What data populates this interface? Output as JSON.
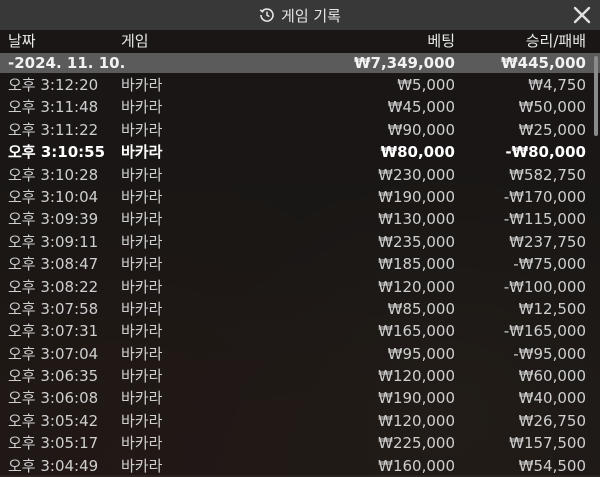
{
  "window": {
    "title": "게임 기록"
  },
  "columns": {
    "date": "날짜",
    "game": "게임",
    "bet": "베팅",
    "winloss": "승리/패배"
  },
  "summary": {
    "date": "-2024. 11. 10.",
    "bet": "₩7,349,000",
    "winloss": "₩445,000"
  },
  "rows": [
    {
      "time": "오후 3:12:20",
      "game": "바카라",
      "bet": "₩5,000",
      "winloss": "₩4,750"
    },
    {
      "time": "오후 3:11:48",
      "game": "바카라",
      "bet": "₩45,000",
      "winloss": "₩50,000"
    },
    {
      "time": "오후 3:11:22",
      "game": "바카라",
      "bet": "₩90,000",
      "winloss": "₩25,000"
    },
    {
      "time": "오후 3:10:55",
      "game": "바카라",
      "bet": "₩80,000",
      "winloss": "-₩80,000"
    },
    {
      "time": "오후 3:10:28",
      "game": "바카라",
      "bet": "₩230,000",
      "winloss": "₩582,750"
    },
    {
      "time": "오후 3:10:04",
      "game": "바카라",
      "bet": "₩190,000",
      "winloss": "-₩170,000"
    },
    {
      "time": "오후 3:09:39",
      "game": "바카라",
      "bet": "₩130,000",
      "winloss": "-₩115,000"
    },
    {
      "time": "오후 3:09:11",
      "game": "바카라",
      "bet": "₩235,000",
      "winloss": "₩237,750"
    },
    {
      "time": "오후 3:08:47",
      "game": "바카라",
      "bet": "₩185,000",
      "winloss": "-₩75,000"
    },
    {
      "time": "오후 3:08:22",
      "game": "바카라",
      "bet": "₩120,000",
      "winloss": "-₩100,000"
    },
    {
      "time": "오후 3:07:58",
      "game": "바카라",
      "bet": "₩85,000",
      "winloss": "₩12,500"
    },
    {
      "time": "오후 3:07:31",
      "game": "바카라",
      "bet": "₩165,000",
      "winloss": "-₩165,000"
    },
    {
      "time": "오후 3:07:04",
      "game": "바카라",
      "bet": "₩95,000",
      "winloss": "-₩95,000"
    },
    {
      "time": "오후 3:06:35",
      "game": "바카라",
      "bet": "₩120,000",
      "winloss": "₩60,000"
    },
    {
      "time": "오후 3:06:08",
      "game": "바카라",
      "bet": "₩190,000",
      "winloss": "₩40,000"
    },
    {
      "time": "오후 3:05:42",
      "game": "바카라",
      "bet": "₩120,000",
      "winloss": "₩26,750"
    },
    {
      "time": "오후 3:05:17",
      "game": "바카라",
      "bet": "₩225,000",
      "winloss": "₩157,500"
    },
    {
      "time": "오후 3:04:49",
      "game": "바카라",
      "bet": "₩160,000",
      "winloss": "₩54,500"
    }
  ],
  "highlight_row": 3
}
